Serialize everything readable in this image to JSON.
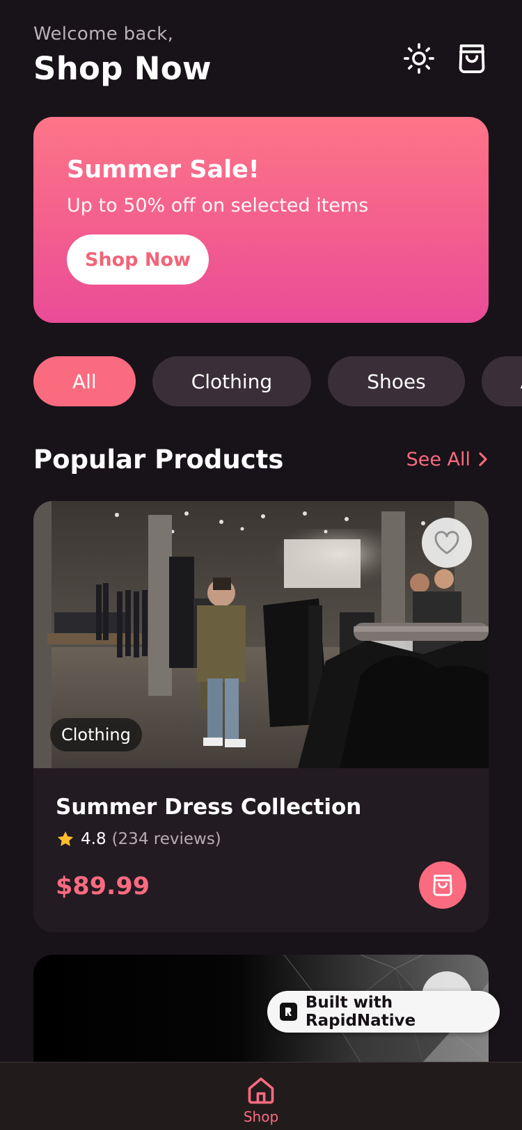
{
  "header": {
    "welcome": "Welcome back,",
    "title": "Shop Now"
  },
  "banner": {
    "title": "Summer Sale!",
    "subtitle": "Up to 50% off on selected items",
    "button": "Shop Now"
  },
  "categories": [
    {
      "label": "All",
      "active": true
    },
    {
      "label": "Clothing"
    },
    {
      "label": "Shoes"
    },
    {
      "label": "Accessories"
    }
  ],
  "section": {
    "title": "Popular Products",
    "see_all": "See All"
  },
  "products": [
    {
      "category": "Clothing",
      "name": "Summer Dress Collection",
      "rating": "4.8",
      "reviews": "(234 reviews)",
      "price": "$89.99"
    }
  ],
  "badge": {
    "label": "Built with RapidNative"
  },
  "tabbar": {
    "shop": "Shop"
  },
  "colors": {
    "accent": "#fb6b80",
    "background": "#181318",
    "card": "#231b22",
    "chip": "#3a2f38"
  },
  "icons": [
    "sun-icon",
    "shopping-bag-icon",
    "chevron-right-icon",
    "heart-icon",
    "star-icon",
    "home-icon"
  ]
}
